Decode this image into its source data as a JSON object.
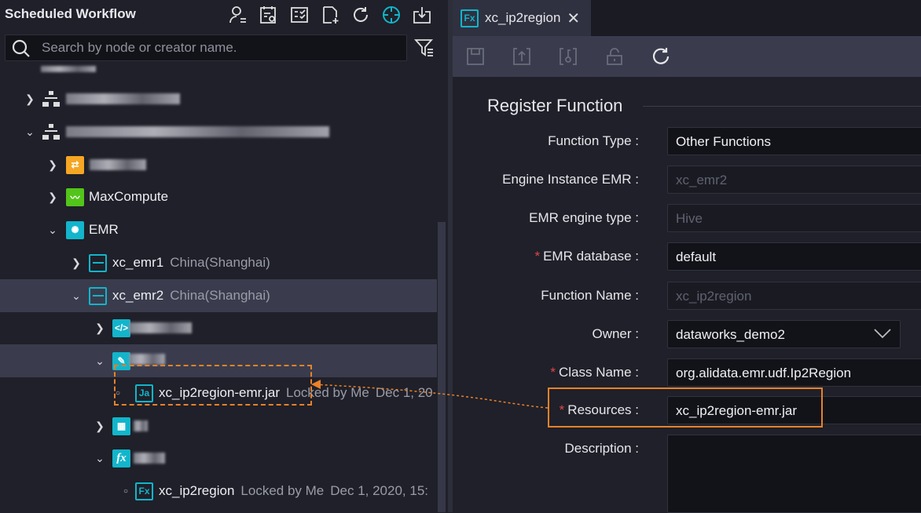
{
  "left": {
    "title": "Scheduled Workflow",
    "toolbar_icons": [
      "person-filter-icon",
      "search-calendar-icon",
      "checklist-icon",
      "new-file-icon",
      "refresh-icon",
      "locate-icon",
      "import-icon"
    ],
    "search_placeholder": "Search by node or creator name.",
    "tree": {
      "maxcompute": "MaxCompute",
      "emr": "EMR",
      "emr1": {
        "name": "xc_emr1",
        "region": "China(Shanghai)"
      },
      "emr2": {
        "name": "xc_emr2",
        "region": "China(Shanghai)"
      },
      "jar": {
        "name": "xc_ip2region-emr.jar",
        "lock": "Locked by Me",
        "date": "Dec 1, 20"
      },
      "fn": {
        "name": "xc_ip2region",
        "lock": "Locked by Me",
        "date": "Dec 1, 2020, 15:"
      },
      "icon_labels": {
        "ja": "Ja",
        "fx": "Fx",
        "fx2": "fx",
        "code": "</>"
      }
    }
  },
  "tab": {
    "label": "xc_ip2region",
    "icon": "Fx"
  },
  "form": {
    "section": "Register Function",
    "fields": [
      {
        "label": "Function Type :",
        "value": "Other Functions",
        "required": false
      },
      {
        "label": "Engine Instance EMR :",
        "value": "xc_emr2",
        "required": false
      },
      {
        "label": "EMR engine type :",
        "value": "Hive",
        "required": false
      },
      {
        "label": "EMR database :",
        "value": "default",
        "required": true
      },
      {
        "label": "Function Name :",
        "value": "xc_ip2region",
        "required": false
      },
      {
        "label": "Owner :",
        "value": "dataworks_demo2",
        "required": false
      },
      {
        "label": "Class Name :",
        "value": "org.alidata.emr.udf.Ip2Region",
        "required": true
      },
      {
        "label": "Resources :",
        "value": "xc_ip2region-emr.jar",
        "required": true
      },
      {
        "label": "Description :",
        "value": "",
        "required": false
      }
    ],
    "req_mark": "*"
  },
  "colors": {
    "accent": "#12b5cb",
    "highlight": "#e9812a"
  }
}
